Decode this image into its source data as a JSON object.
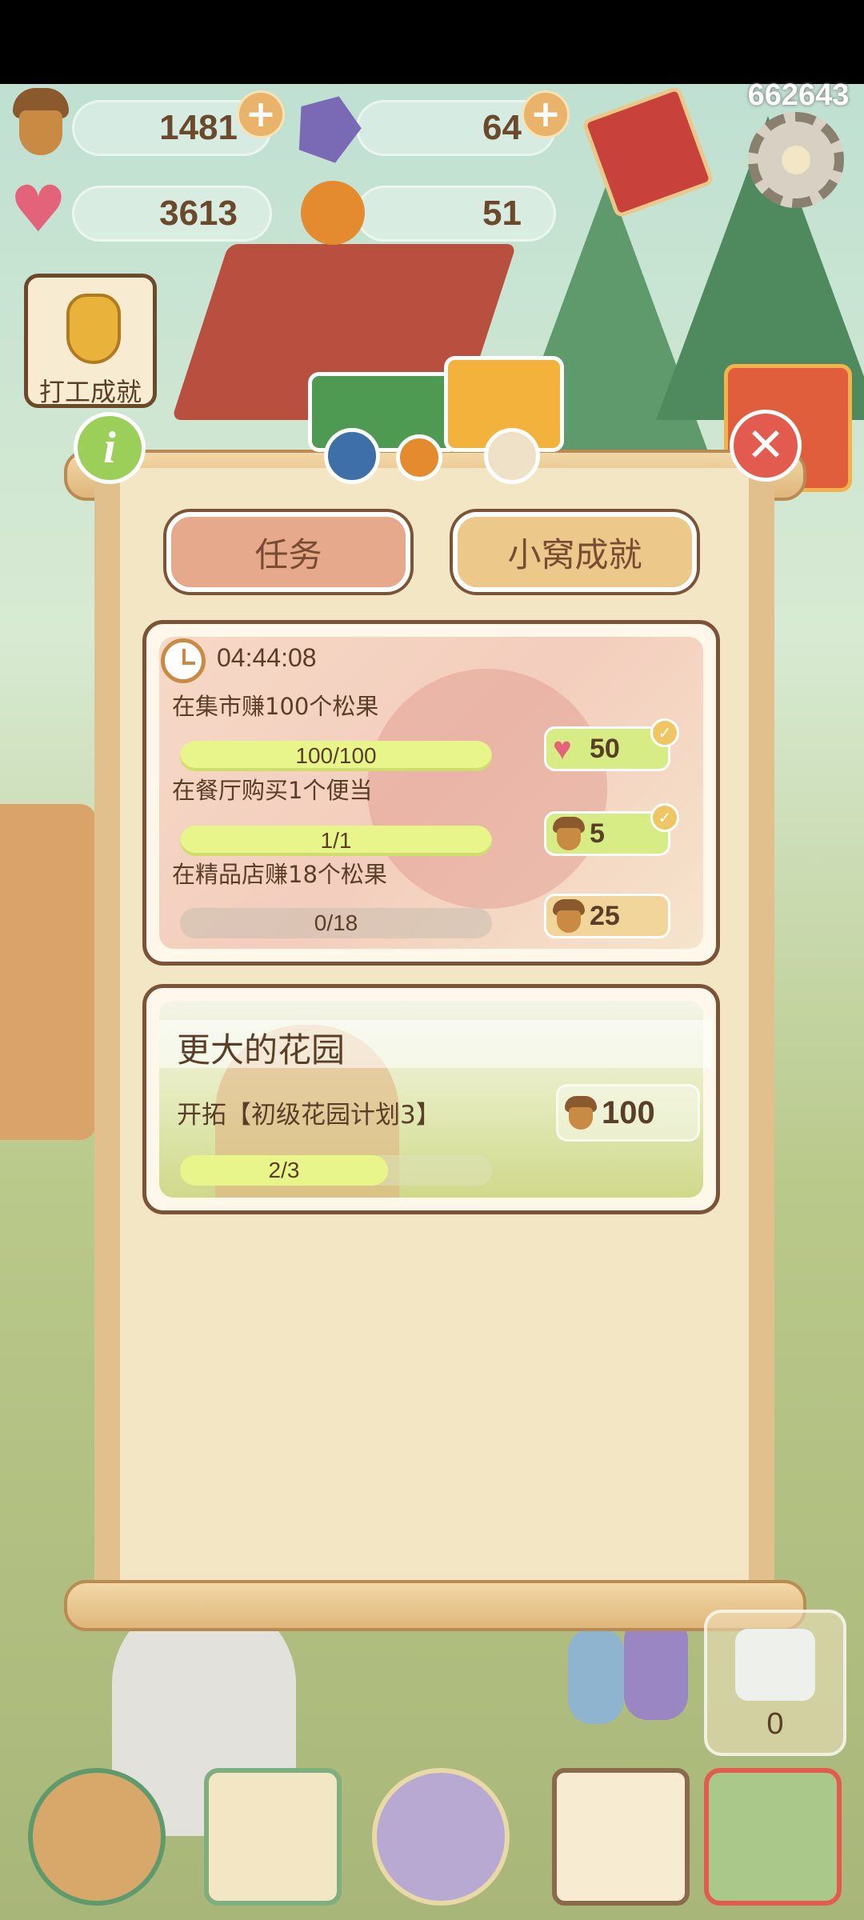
{
  "currencies": {
    "acorns": "1481",
    "gems": "64",
    "hearts": "3613",
    "oranges": "51"
  },
  "player_id": "662643",
  "left_button": {
    "label": "打工成就"
  },
  "tabs": [
    {
      "label": "任务",
      "active": true
    },
    {
      "label": "小窝成就",
      "active": false
    }
  ],
  "daily_card": {
    "timer": "04:44:08",
    "tasks": [
      {
        "label": "在集市赚100个松果",
        "progress_text": "100/100",
        "progress": 1.0,
        "reward_icon": "heart-icon",
        "reward": "50",
        "claimed": true
      },
      {
        "label": "在餐厅购买1个便当",
        "progress_text": "1/1",
        "progress": 1.0,
        "reward_icon": "acorn-icon",
        "reward": "5",
        "claimed": true
      },
      {
        "label": "在精品店赚18个松果",
        "progress_text": "0/18",
        "progress": 0.0,
        "reward_icon": "acorn-icon",
        "reward": "25",
        "claimed": false
      }
    ]
  },
  "garden_card": {
    "title": "更大的花园",
    "task": "开拓【初级花园计划3】",
    "progress_text": "2/3",
    "progress": 0.667,
    "reward_icon": "acorn-icon",
    "reward": "100"
  },
  "gift_box": {
    "count": "0"
  },
  "colors": {
    "active_tab": "#e7a98b",
    "inactive_tab": "#ecc98a",
    "progress_fill": "#e8f58a",
    "panel": "#f2e6c4",
    "frame_brown": "#7b5336"
  }
}
